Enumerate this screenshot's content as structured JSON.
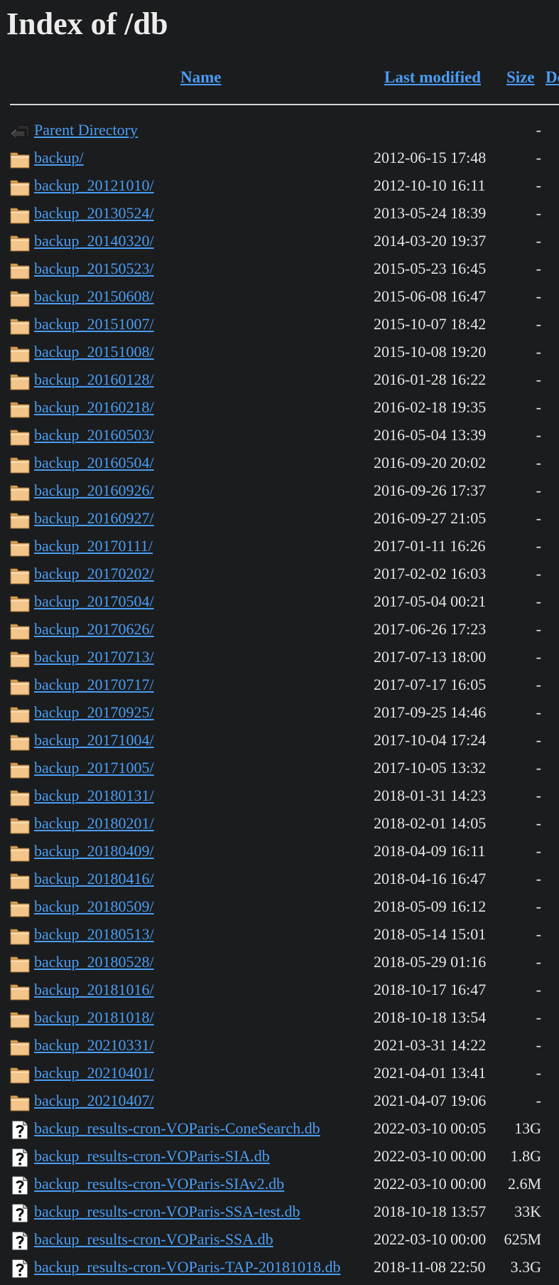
{
  "page": {
    "title": "Index of /db"
  },
  "columns": {
    "name": "Name",
    "last_modified": "Last modified",
    "size": "Size",
    "description": "De"
  },
  "colors": {
    "background": "#1b1c1e",
    "link": "#4a9df3",
    "text": "#e6e6e6",
    "folder_icon": "#f3c58a"
  },
  "entries": [
    {
      "icon": "back-icon",
      "name": "Parent Directory",
      "modified": "",
      "size": "-"
    },
    {
      "icon": "folder-icon",
      "name": "backup/",
      "modified": "2012-06-15 17:48",
      "size": "-"
    },
    {
      "icon": "folder-icon",
      "name": "backup_20121010/",
      "modified": "2012-10-10 16:11",
      "size": "-"
    },
    {
      "icon": "folder-icon",
      "name": "backup_20130524/",
      "modified": "2013-05-24 18:39",
      "size": "-"
    },
    {
      "icon": "folder-icon",
      "name": "backup_20140320/",
      "modified": "2014-03-20 19:37",
      "size": "-"
    },
    {
      "icon": "folder-icon",
      "name": "backup_20150523/",
      "modified": "2015-05-23 16:45",
      "size": "-"
    },
    {
      "icon": "folder-icon",
      "name": "backup_20150608/",
      "modified": "2015-06-08 16:47",
      "size": "-"
    },
    {
      "icon": "folder-icon",
      "name": "backup_20151007/",
      "modified": "2015-10-07 18:42",
      "size": "-"
    },
    {
      "icon": "folder-icon",
      "name": "backup_20151008/",
      "modified": "2015-10-08 19:20",
      "size": "-"
    },
    {
      "icon": "folder-icon",
      "name": "backup_20160128/",
      "modified": "2016-01-28 16:22",
      "size": "-"
    },
    {
      "icon": "folder-icon",
      "name": "backup_20160218/",
      "modified": "2016-02-18 19:35",
      "size": "-"
    },
    {
      "icon": "folder-icon",
      "name": "backup_20160503/",
      "modified": "2016-05-04 13:39",
      "size": "-"
    },
    {
      "icon": "folder-icon",
      "name": "backup_20160504/",
      "modified": "2016-09-20 20:02",
      "size": "-"
    },
    {
      "icon": "folder-icon",
      "name": "backup_20160926/",
      "modified": "2016-09-26 17:37",
      "size": "-"
    },
    {
      "icon": "folder-icon",
      "name": "backup_20160927/",
      "modified": "2016-09-27 21:05",
      "size": "-"
    },
    {
      "icon": "folder-icon",
      "name": "backup_20170111/",
      "modified": "2017-01-11 16:26",
      "size": "-"
    },
    {
      "icon": "folder-icon",
      "name": "backup_20170202/",
      "modified": "2017-02-02 16:03",
      "size": "-"
    },
    {
      "icon": "folder-icon",
      "name": "backup_20170504/",
      "modified": "2017-05-04 00:21",
      "size": "-"
    },
    {
      "icon": "folder-icon",
      "name": "backup_20170626/",
      "modified": "2017-06-26 17:23",
      "size": "-"
    },
    {
      "icon": "folder-icon",
      "name": "backup_20170713/",
      "modified": "2017-07-13 18:00",
      "size": "-"
    },
    {
      "icon": "folder-icon",
      "name": "backup_20170717/",
      "modified": "2017-07-17 16:05",
      "size": "-"
    },
    {
      "icon": "folder-icon",
      "name": "backup_20170925/",
      "modified": "2017-09-25 14:46",
      "size": "-"
    },
    {
      "icon": "folder-icon",
      "name": "backup_20171004/",
      "modified": "2017-10-04 17:24",
      "size": "-"
    },
    {
      "icon": "folder-icon",
      "name": "backup_20171005/",
      "modified": "2017-10-05 13:32",
      "size": "-"
    },
    {
      "icon": "folder-icon",
      "name": "backup_20180131/",
      "modified": "2018-01-31 14:23",
      "size": "-"
    },
    {
      "icon": "folder-icon",
      "name": "backup_20180201/",
      "modified": "2018-02-01 14:05",
      "size": "-"
    },
    {
      "icon": "folder-icon",
      "name": "backup_20180409/",
      "modified": "2018-04-09 16:11",
      "size": "-"
    },
    {
      "icon": "folder-icon",
      "name": "backup_20180416/",
      "modified": "2018-04-16 16:47",
      "size": "-"
    },
    {
      "icon": "folder-icon",
      "name": "backup_20180509/",
      "modified": "2018-05-09 16:12",
      "size": "-"
    },
    {
      "icon": "folder-icon",
      "name": "backup_20180513/",
      "modified": "2018-05-14 15:01",
      "size": "-"
    },
    {
      "icon": "folder-icon",
      "name": "backup_20180528/",
      "modified": "2018-05-29 01:16",
      "size": "-"
    },
    {
      "icon": "folder-icon",
      "name": "backup_20181016/",
      "modified": "2018-10-17 16:47",
      "size": "-"
    },
    {
      "icon": "folder-icon",
      "name": "backup_20181018/",
      "modified": "2018-10-18 13:54",
      "size": "-"
    },
    {
      "icon": "folder-icon",
      "name": "backup_20210331/",
      "modified": "2021-03-31 14:22",
      "size": "-"
    },
    {
      "icon": "folder-icon",
      "name": "backup_20210401/",
      "modified": "2021-04-01 13:41",
      "size": "-"
    },
    {
      "icon": "folder-icon",
      "name": "backup_20210407/",
      "modified": "2021-04-07 19:06",
      "size": "-"
    },
    {
      "icon": "unknown-file-icon",
      "name": "backup_results-cron-VOParis-ConeSearch.db",
      "modified": "2022-03-10 00:05",
      "size": "13G"
    },
    {
      "icon": "unknown-file-icon",
      "name": "backup_results-cron-VOParis-SIA.db",
      "modified": "2022-03-10 00:00",
      "size": "1.8G"
    },
    {
      "icon": "unknown-file-icon",
      "name": "backup_results-cron-VOParis-SIAv2.db",
      "modified": "2022-03-10 00:00",
      "size": "2.6M"
    },
    {
      "icon": "unknown-file-icon",
      "name": "backup_results-cron-VOParis-SSA-test.db",
      "modified": "2018-10-18 13:57",
      "size": "33K"
    },
    {
      "icon": "unknown-file-icon",
      "name": "backup_results-cron-VOParis-SSA.db",
      "modified": "2022-03-10 00:00",
      "size": "625M"
    },
    {
      "icon": "unknown-file-icon",
      "name": "backup_results-cron-VOParis-TAP-20181018.db",
      "modified": "2018-11-08 22:50",
      "size": "3.3G"
    }
  ]
}
